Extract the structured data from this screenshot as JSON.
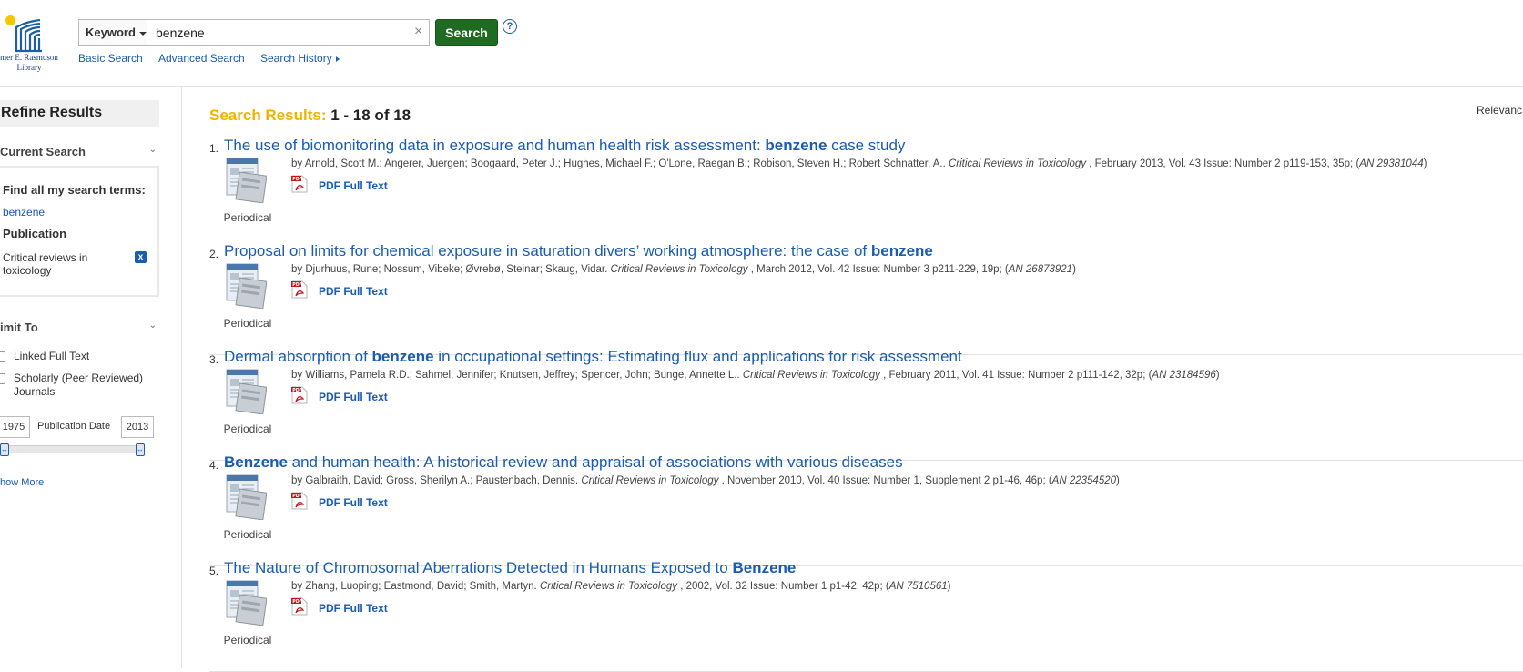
{
  "header": {
    "logo_text_line1": "mer E. Rasmuson",
    "logo_text_line2": "Library",
    "field_select": "Keyword",
    "search_value": "benzene",
    "clear_symbol": "×",
    "search_button": "Search",
    "help_symbol": "?",
    "nav": {
      "basic": "Basic Search",
      "advanced": "Advanced Search",
      "history": "Search History"
    }
  },
  "sidebar": {
    "refine_title": "Refine Results",
    "current_search_title": "Current Search",
    "find_all_label": "Find all my search terms:",
    "search_term": "benzene",
    "publication_label": "Publication",
    "publication_value": "Critical reviews in toxicology",
    "remove_symbol": "x",
    "limit_title": "imit To",
    "limit_options": [
      "Linked Full Text",
      "Scholarly (Peer Reviewed) Journals"
    ],
    "date_from": "1975",
    "date_label": "Publication Date",
    "date_to": "2013",
    "show_more": "how More"
  },
  "main": {
    "results_label": "Search Results:",
    "results_count": "1 - 18 of 18",
    "sort_label": "Relevanc",
    "pdf_label": "PDF Full Text",
    "type_label": "Periodical",
    "results": [
      {
        "num": "1.",
        "title_before": "The use of biomonitoring data in exposure and human health risk assessment: ",
        "title_bold": "benzene",
        "title_after": " case study",
        "authors": "by Arnold, Scott M.; Angerer, Juergen; Boogaard, Peter J.; Hughes, Michael F.; O'Lone, Raegan B.; Robison, Steven H.; Robert Schnatter, A.. ",
        "journal": "Critical Reviews in Toxicology",
        "details": " , February 2013, Vol. 43 Issue: Number 2 p119-153, 35p; (",
        "an": "AN 29381044",
        "close": ")"
      },
      {
        "num": "2.",
        "title_before": "Proposal on limits for chemical exposure in saturation divers’ working atmosphere: the case of ",
        "title_bold": "benzene",
        "title_after": "",
        "authors": "by Djurhuus, Rune; Nossum, Vibeke; Øvrebø, Steinar; Skaug, Vidar. ",
        "journal": "Critical Reviews in Toxicology",
        "details": " , March 2012, Vol. 42 Issue: Number 3 p211-229, 19p; (",
        "an": "AN 26873921",
        "close": ")"
      },
      {
        "num": "3.",
        "title_before": "Dermal absorption of ",
        "title_bold": "benzene",
        "title_after": " in occupational settings: Estimating flux and applications for risk assessment",
        "authors": "by Williams, Pamela R.D.; Sahmel, Jennifer; Knutsen, Jeffrey; Spencer, John; Bunge, Annette L.. ",
        "journal": "Critical Reviews in Toxicology",
        "details": " , February 2011, Vol. 41 Issue: Number 2 p111-142, 32p; (",
        "an": "AN 23184596",
        "close": ")"
      },
      {
        "num": "4.",
        "title_before": "",
        "title_bold": "Benzene",
        "title_after": " and human health: A historical review and appraisal of associations with various diseases",
        "authors": "by Galbraith, David; Gross, Sherilyn A.; Paustenbach, Dennis. ",
        "journal": "Critical Reviews in Toxicology",
        "details": " , November 2010, Vol. 40 Issue: Number 1, Supplement 2 p1-46, 46p; (",
        "an": "AN 22354520",
        "close": ")"
      },
      {
        "num": "5.",
        "title_before": "The Nature of Chromosomal Aberrations Detected in Humans Exposed to ",
        "title_bold": "Benzene",
        "title_after": "",
        "authors": "by Zhang, Luoping; Eastmond, David; Smith, Martyn. ",
        "journal": "Critical Reviews in Toxicology",
        "details": " , 2002, Vol. 32 Issue: Number 1 p1-42, 42p; (",
        "an": "AN 7510561",
        "close": ")"
      }
    ]
  }
}
